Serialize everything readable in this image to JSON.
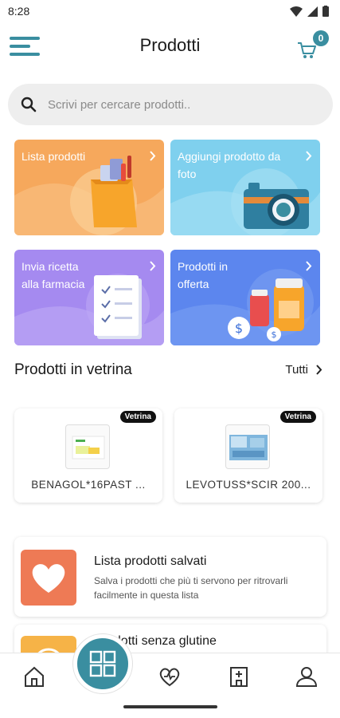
{
  "status_bar": {
    "time": "8:28"
  },
  "app_bar": {
    "title": "Prodotti",
    "cart_count": "0"
  },
  "search": {
    "placeholder": "Scrivi per cercare prodotti.."
  },
  "categories": [
    {
      "label": "Lista prodotti",
      "color": "#f6a85c",
      "icon": "shopping-bag-icon"
    },
    {
      "label": "Aggiungi prodotto da foto",
      "color": "#7fd0ee",
      "icon": "camera-icon"
    },
    {
      "label": "Invia ricetta alla farmacia",
      "color": "#a58af0",
      "icon": "prescription-document-icon"
    },
    {
      "label": "Prodotti in offerta",
      "color": "#5c86ee",
      "icon": "medicine-bottles-icon"
    }
  ],
  "showcase": {
    "title": "Prodotti in vetrina",
    "see_all": "Tutti",
    "products": [
      {
        "badge": "Vetrina",
        "name": "BENAGOL*16PAST ..."
      },
      {
        "badge": "Vetrina",
        "name": "LEVOTUSS*SCIR 200..."
      }
    ]
  },
  "lists": [
    {
      "title": "Lista prodotti salvati",
      "description": "Salva i prodotti che più ti servono per ritrovarli facilmente in questa lista",
      "color": "#ee7a55",
      "icon": "heart-icon"
    },
    {
      "title": "Prodotti senza glutine",
      "description": "",
      "color": "#f6b347",
      "icon": "gluten-free-icon"
    }
  ],
  "bottom_nav": [
    "home-icon",
    "grid-icon",
    "health-heart-icon",
    "pharmacy-building-icon",
    "profile-icon"
  ],
  "colors": {
    "accent": "#3a8ea0"
  }
}
